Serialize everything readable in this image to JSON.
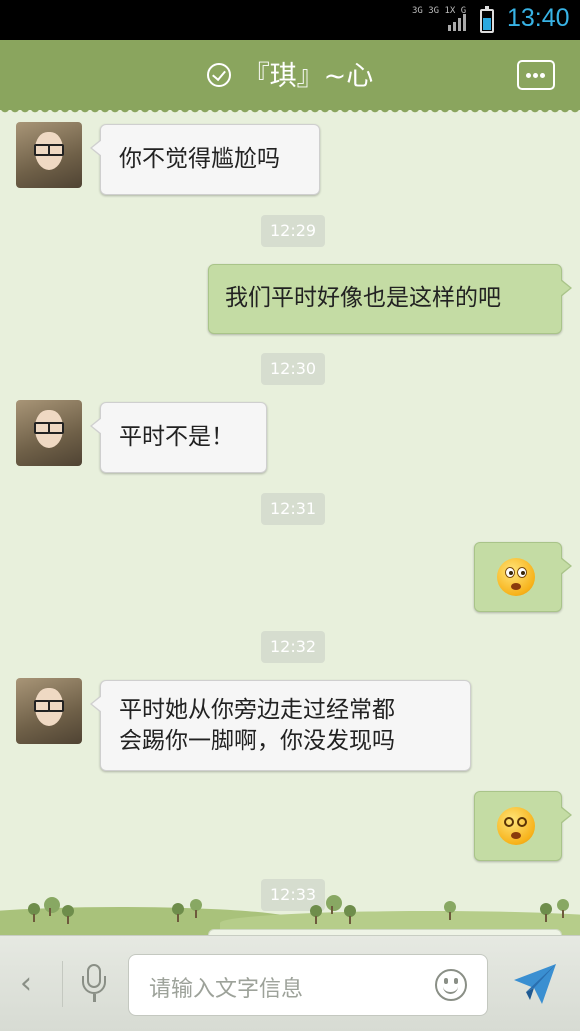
{
  "status_bar": {
    "time": "13:40",
    "network_text": "3G 3G 1X G",
    "battery_level": 0.6
  },
  "header": {
    "contact_name": "『琪』~心",
    "verified_icon": "check-circle-icon",
    "more_icon": "more-dots-icon"
  },
  "messages": [
    {
      "side": "left",
      "text": "你不觉得尴尬吗"
    },
    {
      "side": "stamp",
      "text": "12:29"
    },
    {
      "side": "right",
      "text": "我们平时好像也是这样的吧"
    },
    {
      "side": "stamp",
      "text": "12:30"
    },
    {
      "side": "left",
      "text": "平时不是！"
    },
    {
      "side": "stamp",
      "text": "12:31"
    },
    {
      "side": "right",
      "emoji": "surprised-emoji"
    },
    {
      "side": "stamp",
      "text": "12:32"
    },
    {
      "side": "left",
      "text_lines": [
        "平时她从你旁边走过经常都",
        "会踢你一脚啊，你没发现吗"
      ]
    },
    {
      "side": "right",
      "emoji": "dizzy-emoji"
    },
    {
      "side": "stamp",
      "text": "12:33"
    }
  ],
  "input_bar": {
    "back_icon": "chevron-left-icon",
    "mic_icon": "microphone-icon",
    "placeholder": "请输入文字信息",
    "emoji_icon": "smiley-icon",
    "send_icon": "send-icon"
  },
  "colors": {
    "header": "#8aa55e",
    "chat_background": "#e8f0dc",
    "outgoing_bubble": "#c4dca4",
    "incoming_bubble": "#f6f6f6",
    "time_accent": "#38b3e5"
  }
}
